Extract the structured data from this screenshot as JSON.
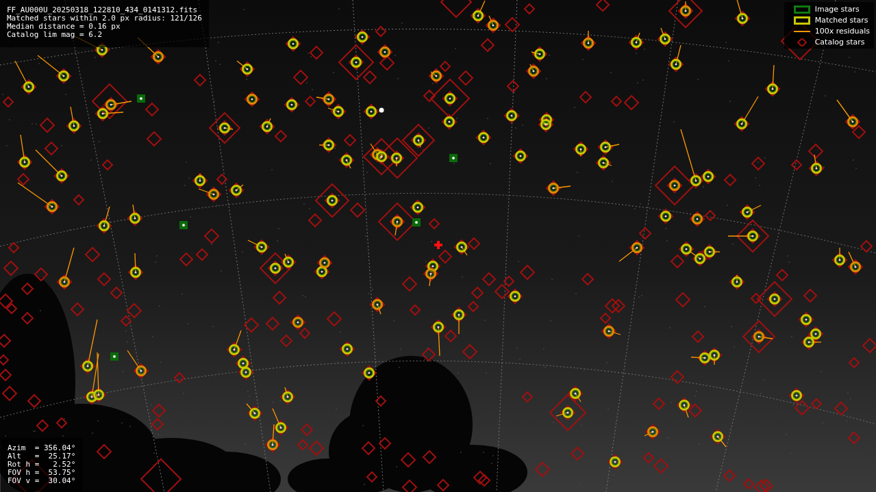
{
  "info_panel": {
    "lines": [
      "FF_AU000U_20250318_122810_434_0141312.fits",
      "Matched stars within 2.0 px radius: 121/126",
      "Median distance = 0.16 px",
      "Catalog lim mag = 6.2"
    ]
  },
  "legend": [
    {
      "kind": "image",
      "label": "Image stars",
      "color": "#0f7a0f"
    },
    {
      "kind": "matched",
      "label": "Matched stars",
      "color": "#c8c800"
    },
    {
      "kind": "residual",
      "label": "100x residuals",
      "color": "#ff9900"
    },
    {
      "kind": "catalog",
      "label": "Catalog stars",
      "color": "#a01010"
    }
  ],
  "pointing_panel": {
    "lines": [
      "Azim  = 356.04°",
      "Alt   =  25.17°",
      "Rot h =   2.52°",
      "FOV h =  53.75°",
      "FOV v =  30.04°"
    ]
  }
}
